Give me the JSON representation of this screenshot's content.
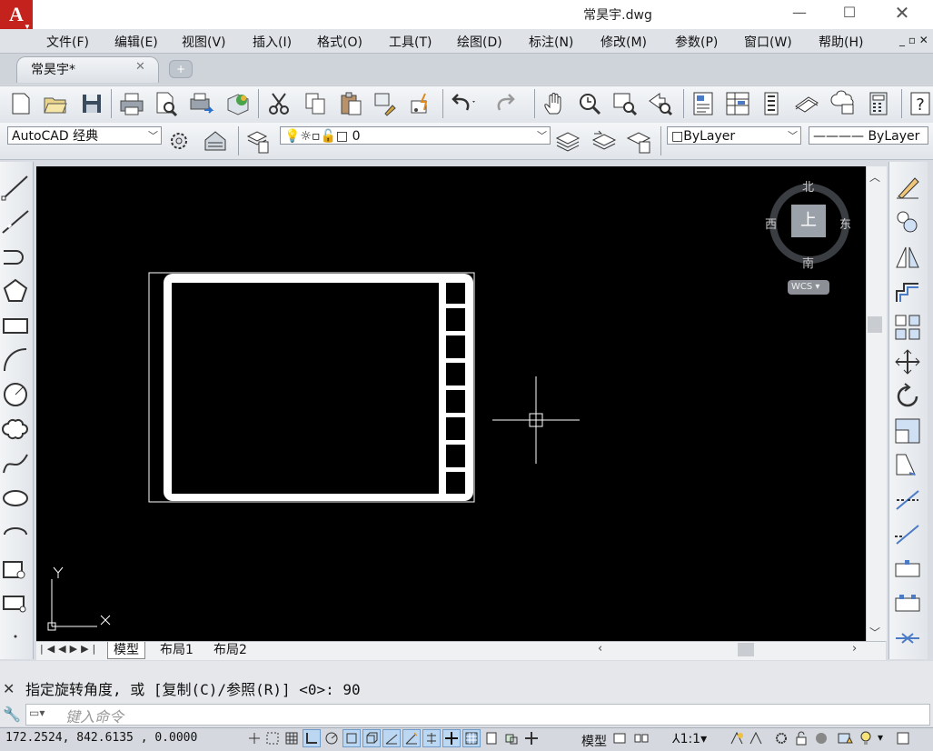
{
  "window": {
    "title": "常昊宇.dwg",
    "app_logo": "A",
    "controls": [
      "minimize-icon",
      "maximize-icon",
      "close-icon"
    ]
  },
  "menu": {
    "items": [
      "文件(F)",
      "编辑(E)",
      "视图(V)",
      "插入(I)",
      "格式(O)",
      "工具(T)",
      "绘图(D)",
      "标注(N)",
      "修改(M)",
      "参数(P)",
      "窗口(W)",
      "帮助(H)"
    ],
    "mdi_controls": "_ ▫ ✕"
  },
  "doc_tab": {
    "label": "常昊宇*",
    "close": "✕",
    "new_tab": "+"
  },
  "toolbar2": {
    "workspace": "AutoCAD 经典",
    "layer": "0",
    "color": "ByLayer",
    "linetype": "ByLayer"
  },
  "viewcube": {
    "north": "北",
    "south": "南",
    "east": "东",
    "west": "西",
    "face": "上",
    "ucs_menu": "WCS"
  },
  "ucs_icon": {
    "x_label": "X",
    "y_label": "Y"
  },
  "layout_tabs": [
    "模型",
    "布局1",
    "布局2"
  ],
  "command": {
    "history": "指定旋转角度, 或 [复制(C)/参照(R)] <0>: 90",
    "placeholder": "键入命令"
  },
  "status": {
    "coords": "172.2524,  842.6135 , 0.0000",
    "model_label": "模型",
    "scale": "1:1"
  },
  "colors": {
    "canvas": "#000000",
    "logo": "#c4221d",
    "drawing": "#ffffff"
  }
}
